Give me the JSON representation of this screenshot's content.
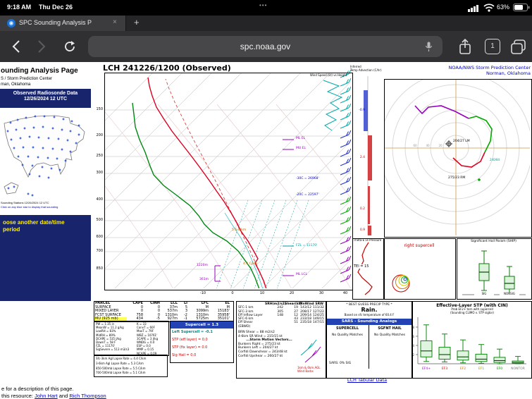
{
  "status_bar": {
    "time": "9:18 AM",
    "date": "Thu Dec 26",
    "menu_dots": "•••",
    "battery_pct": "63%"
  },
  "tab_bar": {
    "tab_title": "SPC Sounding Analysis P",
    "close_glyph": "×",
    "new_tab_glyph": "+"
  },
  "toolbar": {
    "url": "spc.noaa.gov",
    "tab_count": "1"
  },
  "sidebar": {
    "title": "ounding Analysis Page",
    "org_line1": "S / Storm Prediction Center",
    "org_line2": "man, Oklahoma",
    "databox_line1": "Observed Radiosonde Data",
    "databox_line2": "12/26/2024 12 UTC",
    "map_caption": "Sounding Stations 12/26/2024 12 UTC",
    "map_hint": "Click on any blue star to display that sounding",
    "choose_link": "oose another date/time period"
  },
  "page_footer": {
    "line1": "e for a description of this page.",
    "line2_prefix": "this resource: ",
    "link1": "John Hart",
    "line2_sep": " and ",
    "link2": "Rich Thompson"
  },
  "sounding": {
    "title": "LCH  241226/1200  (Observed)",
    "credit1": "NOAA/NWS Storm Prediction Center",
    "credit2": "Norman, Oklahoma",
    "pressure_labels": [
      "150",
      "200",
      "250",
      "300",
      "400",
      "500",
      "600",
      "700",
      "850"
    ],
    "temp_labels": [
      "-10",
      "0",
      "10",
      "20",
      "30",
      "40"
    ],
    "ann": {
      "ml_el": "ML EL",
      "mu_el": "MU EL",
      "m30": "-30C = 26968'",
      "m20": "-20C = 22597'",
      "fzl": "FZL = 11170'",
      "ml_lcl": "ML LCL",
      "lr_mid": "5.6 C/km",
      "lr_low": "4.4 C/km",
      "eil_top": "1220m",
      "eil_bot": "361m"
    },
    "wind_inset_label": "Wind Speed (kt) vs Height",
    "adv_label1": "Inferred",
    "adv_label2": "Temp Advection (C/hr)",
    "adv_values": [
      "-0.9",
      "2.4",
      "0.2",
      "0.9"
    ],
    "theta_e_title": "Theta-E vs Pressure",
    "tei": "TEI = 15",
    "hodo": {
      "lm": "204/27 LM",
      "rm": "275/23 RM",
      "dtm": "240/84",
      "ring_labels": [
        "20",
        "40",
        "60"
      ]
    },
    "watch_text": "right supercell",
    "ship_title": "Significant Hail Param (SHIP)",
    "ship_labels": [
      "SIG",
      "NONSIG"
    ],
    "parcel": {
      "headers": [
        "PARCEL",
        "CAPE",
        "CINH",
        "LCL",
        "LI",
        "LFC",
        "EL"
      ],
      "rows": [
        [
          "SURFACE",
          "0",
          "0",
          "37m",
          "5",
          "M",
          "M"
        ],
        [
          "MIXED LAYER",
          "0",
          "0",
          "537m",
          "3",
          "3099m",
          "15183'"
        ],
        [
          "FCST SURFACE",
          "758",
          "0",
          "1310m",
          "-2",
          "1310m",
          "35958'"
        ],
        [
          "MU (925 mb)",
          "434",
          "-5",
          "927m",
          "-1",
          "5725m",
          "35101'"
        ]
      ]
    },
    "indices_col1": [
      "PW = 1.35 in",
      "MeanW = 11.2 g/kg",
      "LowRH = 83%",
      "MidRH = 89%",
      "DCAPE = 535 J/kg",
      "DownT = 58 F",
      "FZL = 11170'",
      "SigSevere = 513 m3/s3"
    ],
    "indices_col2": [
      "K = 33",
      "ConvT = 60F",
      "MaxT = 79F",
      "WBZ = 10761'",
      "3CAPE = 3 J/kg",
      "WNDG = 0.0",
      "ESP = 0.0",
      "MMP = 0.15",
      "NCAPE = 0.09"
    ],
    "lapse_rates": [
      "Sfc-3km Agl Lapse Rate = 4.4 C/km",
      "3-6km Agl Lapse Rate = 5.3 C/km",
      "850-500mb Lapse Rate = 5.5 C/km",
      "700-500mb Lapse Rate = 5.1 C/km"
    ],
    "supercell": {
      "main": "Supercell = 1.3",
      "left": "Left Supercell = -0.1",
      "stp_eff": "STP (eff layer) = 0.0",
      "stp_fix": "STP (fix layer) = 0.0",
      "sig_hail": "Sig Hail = 0.0"
    },
    "srh": {
      "headers": [
        "",
        "SRH(m2/s2)",
        "Shear(kt)",
        "MnWind",
        "SRW"
      ],
      "rows": [
        [
          "SFC-1 km",
          "242",
          "19",
          "143/12",
          "111/32"
        ],
        [
          "SFC-3 km",
          "305",
          "27",
          "208/17",
          "127/22"
        ],
        [
          "Eff Inflow Layer",
          "148",
          "12",
          "209/14",
          "124/25"
        ],
        [
          "SFC-6 km",
          "",
          "43",
          "233/18",
          "149/15"
        ],
        [
          "Eff Shear (EBWD)",
          "",
          "51",
          "235/18",
          "147/15"
        ]
      ],
      "brn": "BRN Shear = 88 m2/s2",
      "srw46": "4-6km SR Wind = 215/15 kt",
      "smv_header": "...Storm Motion Vectors...",
      "bunkers_right": "Bunkers Right = 275/23 kt",
      "bunkers_left": "Bunkers Left = 204/27 kt",
      "corfidi_down": "Corfidi Downshear = 243/48 kt",
      "corfidi_up": "Corfidi Upshear = 260/27 kt",
      "barb_caption": "1km & 6km AGL Wind Barbs"
    },
    "sars": {
      "precip_header": "* BEST GUESS PRECIP TYPE *",
      "precip_value": "Rain.",
      "precip_note": "Based on sfc temperature of 60.4 F",
      "title": "SARS - Sounding Analogs",
      "col1": "SUPERCELL",
      "col2": "SGFNT HAIL",
      "match1": "No Quality Matches",
      "match2": "No Quality Matches",
      "footer": "SARS: 0% SIG"
    },
    "stp_box": {
      "title": "Effective-Layer STP (with CIN)",
      "sub1": "Prob EF2+ torn with supercell",
      "sub2": "(Sounding CLIMO v. STP sigtor)",
      "categories": [
        "EF4+",
        "EF3",
        "EF2",
        "EF1",
        "EF0",
        "NONTOR"
      ],
      "yticks": [
        "2",
        "4",
        "6",
        "8"
      ]
    },
    "tabular_link": "LCH Tabular Data"
  }
}
